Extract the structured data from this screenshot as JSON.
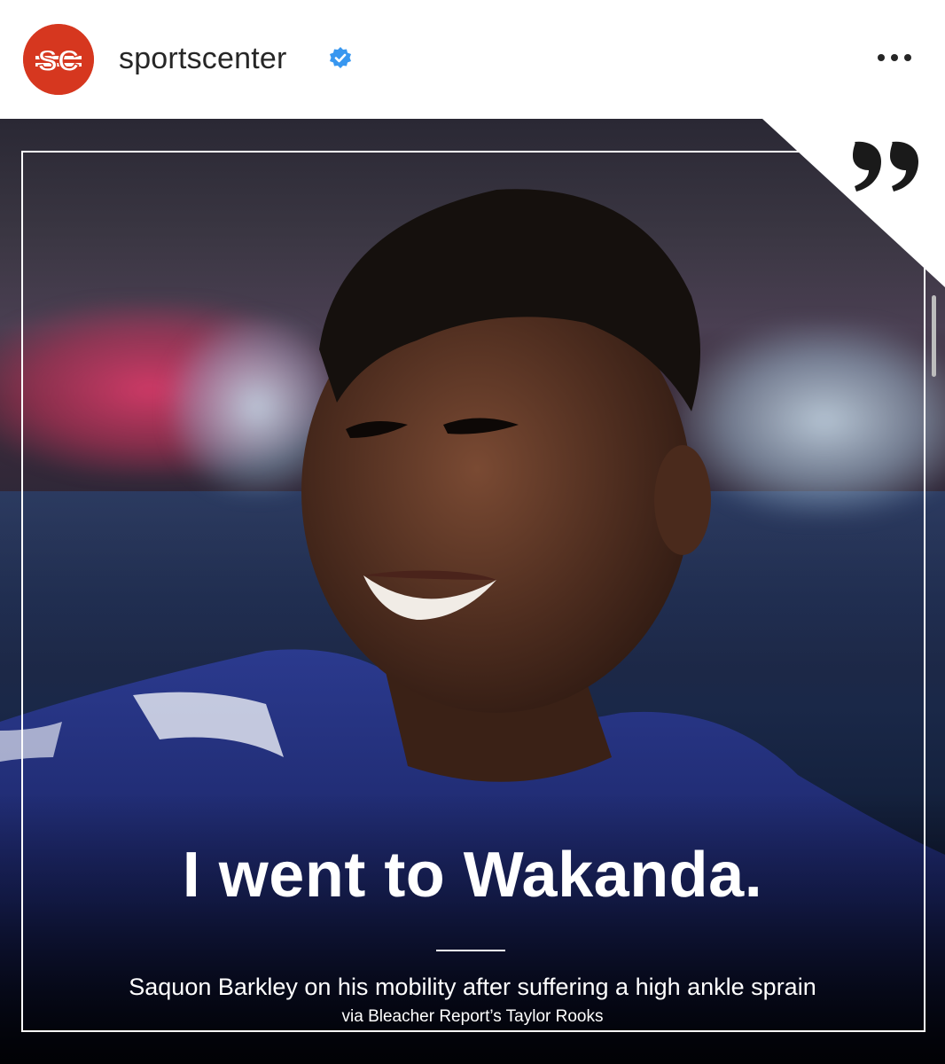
{
  "header": {
    "username": "sportscenter",
    "avatar_logo_text": "SC",
    "avatar_color": "#d6371f",
    "verified_color": "#3897f0",
    "more_icon": "more-horizontal-icon"
  },
  "post": {
    "image_description_icon": "quote-icon",
    "headline": "I went to Wakanda.",
    "subheadline": "Saquon Barkley on his mobility after suffering a high ankle sprain",
    "credit": "via Bleacher Report’s Taylor Rooks"
  },
  "colors": {
    "accent_white": "#ffffff",
    "text_dark": "#262626"
  }
}
